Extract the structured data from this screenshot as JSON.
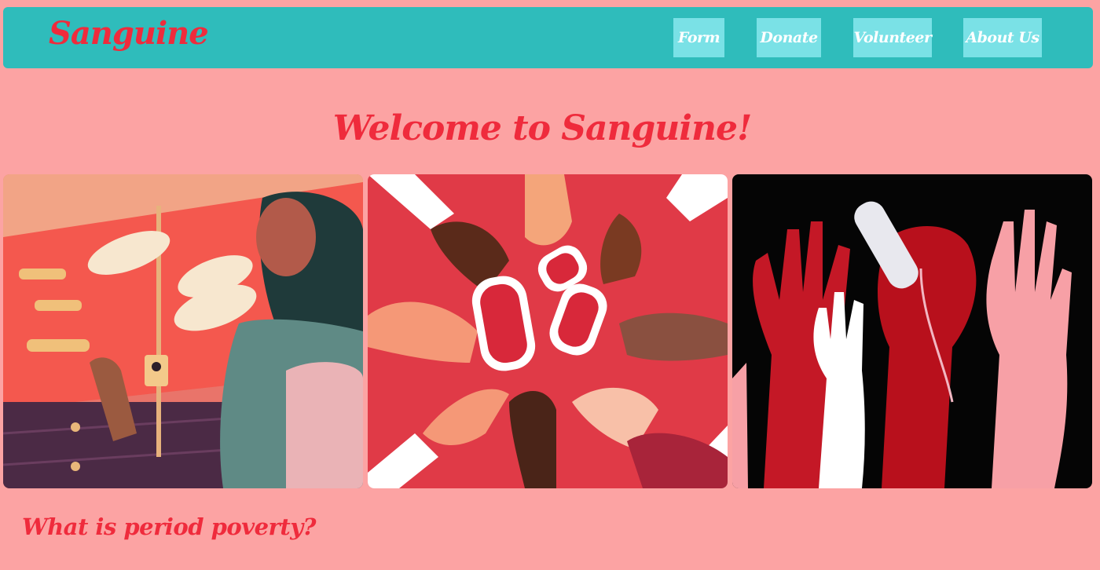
{
  "header": {
    "brand": "Sanguine",
    "nav": [
      {
        "label": "Form"
      },
      {
        "label": "Donate"
      },
      {
        "label": "Volunteer"
      },
      {
        "label": "About Us"
      }
    ]
  },
  "main": {
    "welcome": "Welcome to Sanguine!",
    "section_heading": "What is period poverty?",
    "images": [
      {
        "name": "girl-at-display-case-illustration"
      },
      {
        "name": "hands-reaching-for-pads-illustration"
      },
      {
        "name": "raised-hands-with-tampon-illustration"
      }
    ]
  },
  "colors": {
    "background": "#fca3a3",
    "navbar": "#2fbcbb",
    "nav_button": "#7ae1e6",
    "accent": "#ef2b3c"
  }
}
